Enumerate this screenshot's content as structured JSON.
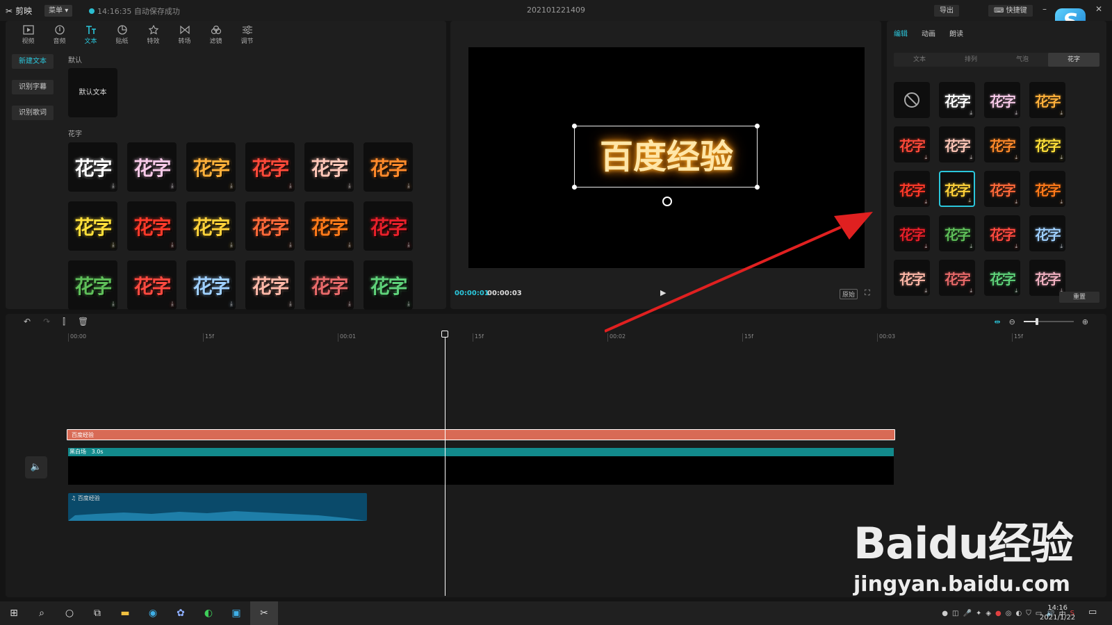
{
  "titlebar": {
    "app_name": "剪映",
    "menu_label": "菜单",
    "autosave": "14:16:35 自动保存成功",
    "project_title": "202101221409",
    "export_label": "导出",
    "shortcut_label": "快捷键"
  },
  "toolbar": {
    "items": [
      "视频",
      "音频",
      "文本",
      "贴纸",
      "特效",
      "转场",
      "滤镜",
      "调节"
    ]
  },
  "sidebar": {
    "buttons": [
      "新建文本",
      "识别字幕",
      "识别歌词"
    ]
  },
  "text_library": {
    "default_section": "默认",
    "default_card": "默认文本",
    "fancy_section": "花字",
    "fancy_cards": [
      {
        "label": "花字",
        "color": "#ffffff"
      },
      {
        "label": "花字",
        "color": "#f7c9e8"
      },
      {
        "label": "花字",
        "color": "#ffb13b"
      },
      {
        "label": "花字",
        "color": "#ff4a3a"
      },
      {
        "label": "花字",
        "color": "#ffc7b8"
      },
      {
        "label": "花字",
        "color": "#ff8a2b"
      },
      {
        "label": "花字",
        "color": "#ffe03a"
      },
      {
        "label": "花字",
        "color": "#ff3a2a"
      },
      {
        "label": "花字",
        "color": "#ffd23a"
      },
      {
        "label": "花字",
        "color": "#ff6a3a"
      },
      {
        "label": "花字",
        "color": "#ff7a1a"
      },
      {
        "label": "花字",
        "color": "#e8202a"
      },
      {
        "label": "花字",
        "color": "#5fbf5a"
      },
      {
        "label": "花字",
        "color": "#ff4a40"
      },
      {
        "label": "花字",
        "color": "#9fd0ff"
      },
      {
        "label": "花字",
        "color": "#ffb8a8"
      },
      {
        "label": "花字",
        "color": "#e86a6a"
      },
      {
        "label": "花字",
        "color": "#5fd27a"
      }
    ]
  },
  "preview": {
    "text": "百度经验",
    "current_time": "00:00:01",
    "total_time": "00:00:03",
    "ratio_label": "原始"
  },
  "right_panel": {
    "tabs": [
      "编辑",
      "动画",
      "朗读"
    ],
    "subtabs": [
      "文本",
      "排列",
      "气泡",
      "花字"
    ],
    "cards": [
      {
        "label": "",
        "color": "#aaaaaa"
      },
      {
        "label": "花字",
        "color": "#ffffff"
      },
      {
        "label": "花字",
        "color": "#f7c9e8"
      },
      {
        "label": "花字",
        "color": "#ffb13b"
      },
      {
        "label": "花字",
        "color": "#ff4a3a"
      },
      {
        "label": "花字",
        "color": "#ffc7b8"
      },
      {
        "label": "花字",
        "color": "#ff8a2b"
      },
      {
        "label": "花字",
        "color": "#ffe03a"
      },
      {
        "label": "花字",
        "color": "#ff3a2a"
      },
      {
        "label": "花字",
        "color": "#ffd23a"
      },
      {
        "label": "花字",
        "color": "#ff6a3a"
      },
      {
        "label": "花字",
        "color": "#ff7a1a"
      },
      {
        "label": "花字",
        "color": "#e8202a"
      },
      {
        "label": "花字",
        "color": "#5fbf5a"
      },
      {
        "label": "花字",
        "color": "#ff4a40"
      },
      {
        "label": "花字",
        "color": "#9fd0ff"
      },
      {
        "label": "花字",
        "color": "#ffb8a8"
      },
      {
        "label": "花字",
        "color": "#e86a6a"
      },
      {
        "label": "花字",
        "color": "#5fd27a"
      },
      {
        "label": "花字",
        "color": "#f0b0c0"
      }
    ],
    "selected_index": 9,
    "reset_label": "重置"
  },
  "timeline": {
    "ruler": [
      "00:00",
      "15f",
      "00:01",
      "15f",
      "00:02",
      "15f",
      "00:03",
      "15f"
    ],
    "text_clip": "百度经验",
    "video_clip": "黑白场",
    "video_duration": "3.0s",
    "audio_clip": "百度经验"
  },
  "watermark": {
    "brand": "Baidu经验",
    "url": "jingyan.baidu.com"
  },
  "taskbar": {
    "time": "14:16",
    "date": "2021/1/22",
    "ime": "中"
  },
  "colors": {
    "accent": "#2bc7dc",
    "text_clip": "#d86a55",
    "video_clip": "#128a8c",
    "audio_clip": "#0a4a6a"
  }
}
